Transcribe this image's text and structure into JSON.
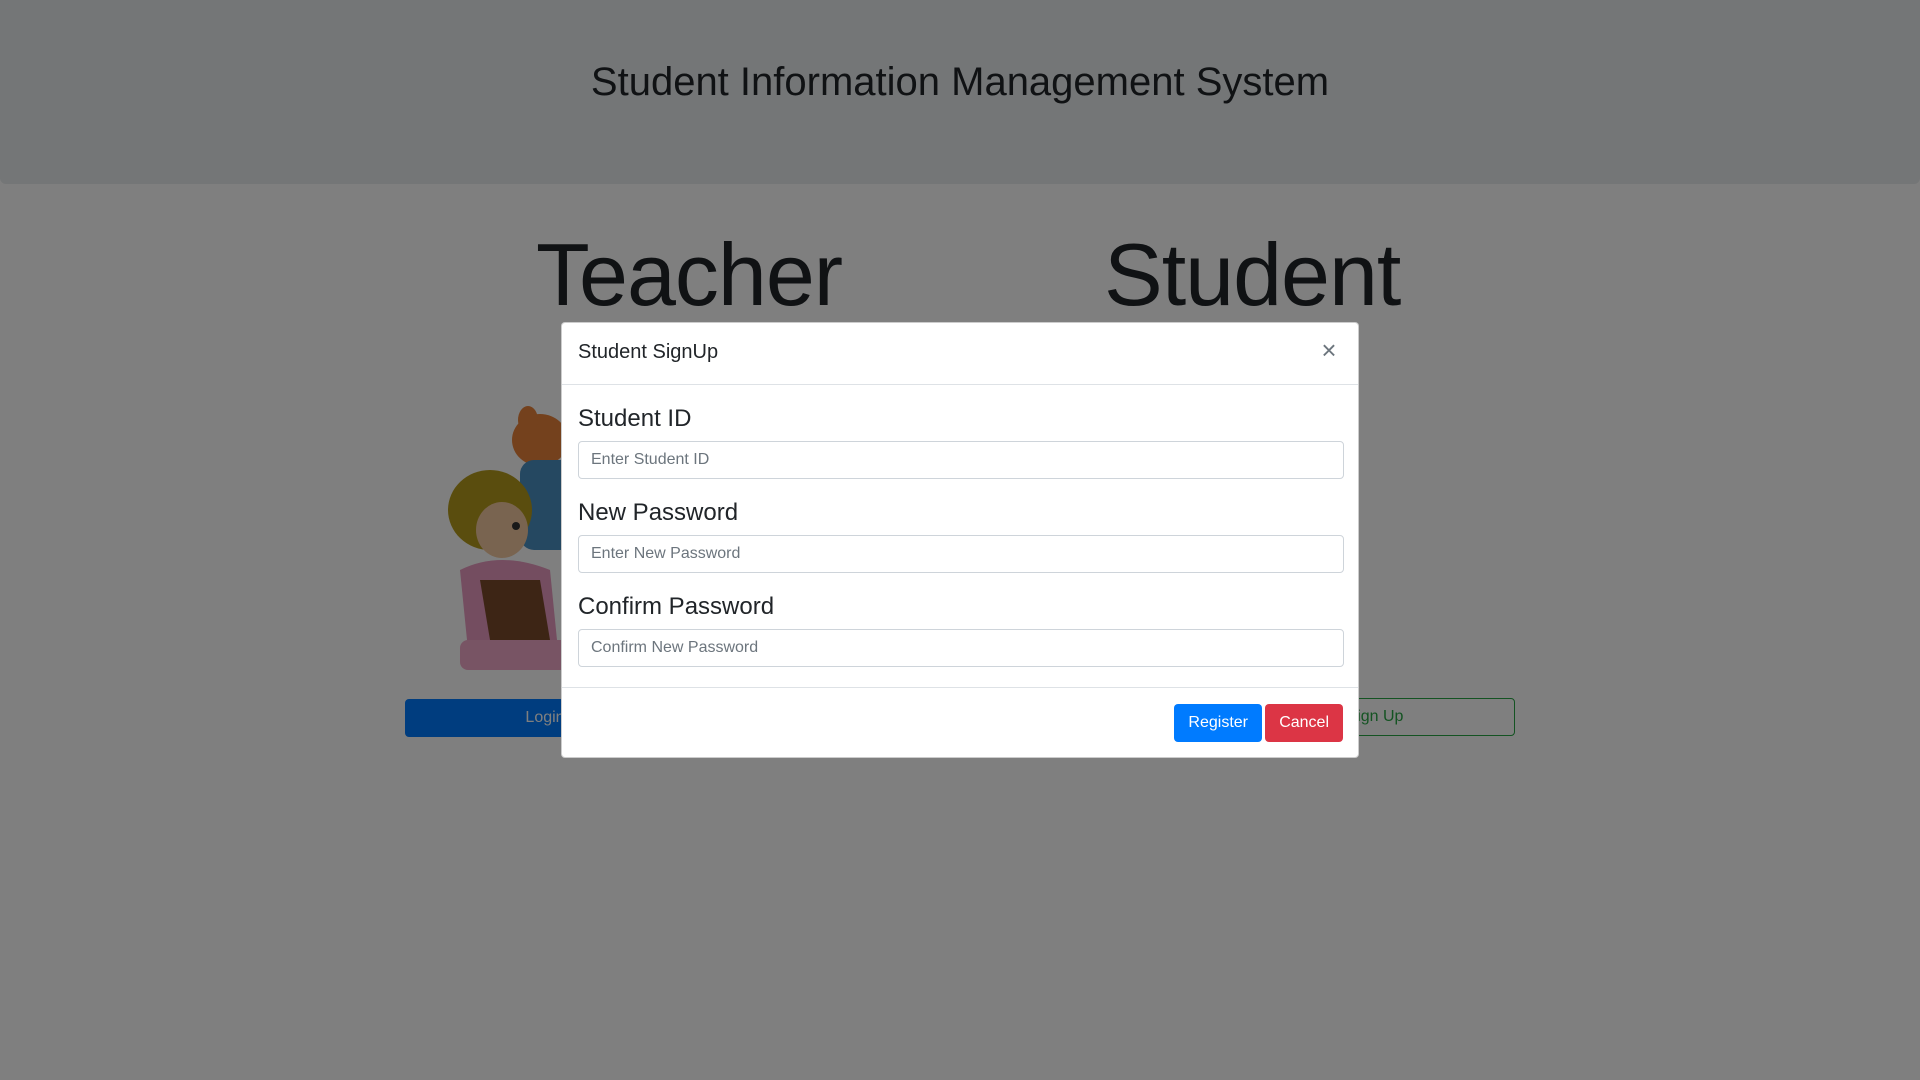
{
  "header": {
    "title": "Student Information Management System"
  },
  "roles": {
    "teacher": "Teacher",
    "student": "Student"
  },
  "background_buttons": {
    "login": "Login",
    "signup": "Sign Up"
  },
  "modal": {
    "title": "Student SignUp",
    "close_symbol": "×",
    "fields": [
      {
        "label": "Student ID",
        "placeholder": "Enter Student ID"
      },
      {
        "label": "New Password",
        "placeholder": "Enter New Password"
      },
      {
        "label": "Confirm Password",
        "placeholder": "Confirm New Password"
      }
    ],
    "register_label": "Register",
    "cancel_label": "Cancel"
  },
  "colors": {
    "primary": "#007bff",
    "danger": "#dc3545",
    "success": "#28a745"
  }
}
